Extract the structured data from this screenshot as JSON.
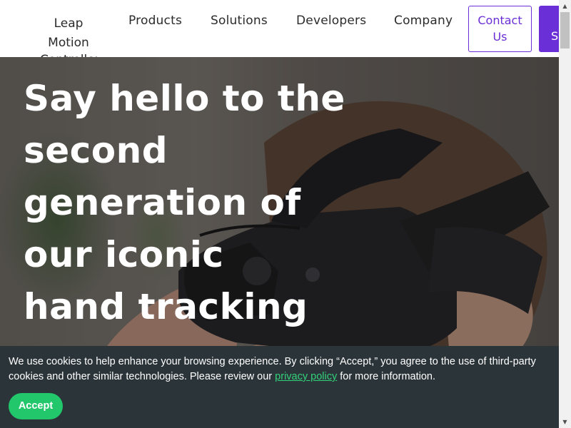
{
  "nav": {
    "brand_line1": "Leap",
    "brand_line2": "Motion",
    "brand_line3": "Controller",
    "items": [
      {
        "label": "Products"
      },
      {
        "label": "Solutions"
      },
      {
        "label": "Developers"
      },
      {
        "label": "Company"
      }
    ],
    "contact_line1": "Contact",
    "contact_line2": "Us",
    "shop_label": "Shop"
  },
  "hero": {
    "heading_lines": [
      "Say hello to the",
      "second",
      "generation of",
      "our iconic",
      "hand tracking"
    ]
  },
  "cookie": {
    "text_before": "We use cookies to help enhance your browsing experience. By clicking “Accept,” you agree to the use of third-party cookies and other similar technologies. Please review our ",
    "link_text": "privacy policy",
    "text_after": " for more information.",
    "accept_label": "Accept"
  },
  "colors": {
    "brand_purple": "#6a2fd6",
    "accept_green": "#22c76c",
    "link_green": "#33d17a",
    "banner_bg": "#2b3439"
  }
}
